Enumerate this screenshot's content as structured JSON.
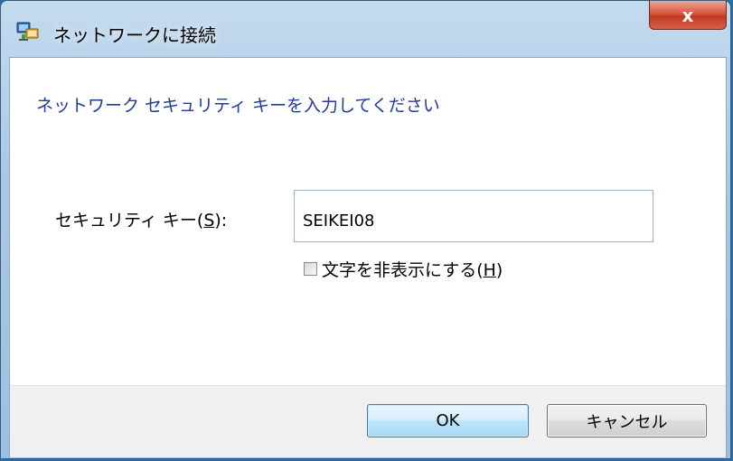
{
  "window": {
    "title": "ネットワークに接続",
    "app_icon": "network-icon",
    "close_glyph": "x"
  },
  "dialog": {
    "heading": "ネットワーク セキュリティ キーを入力してください",
    "security_key": {
      "label_prefix": "セキュリティ キー(",
      "accelerator": "S",
      "label_suffix": "):",
      "value": "SEIKEI08"
    },
    "hide_characters": {
      "label_prefix": "文字を非表示にする(",
      "accelerator": "H",
      "label_suffix": ")",
      "checked": false
    }
  },
  "footer": {
    "ok_label": "OK",
    "cancel_label": "キャンセル"
  },
  "colors": {
    "heading": "#1e3d96",
    "titlebar": "#a9c8e6",
    "close_button": "#c13a24"
  }
}
